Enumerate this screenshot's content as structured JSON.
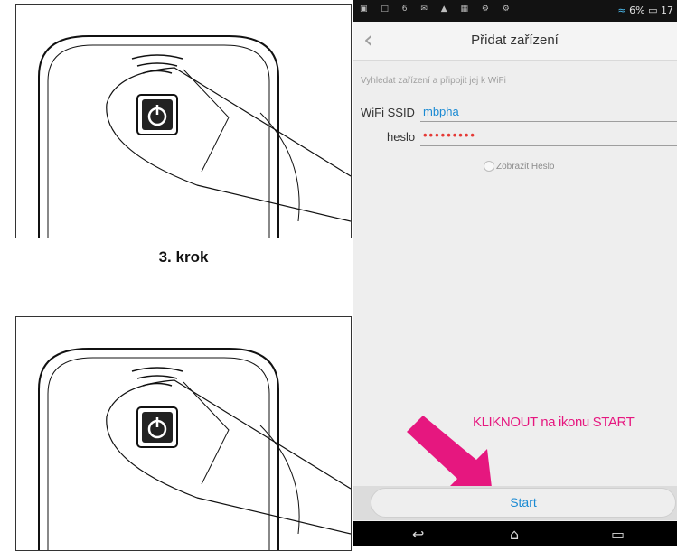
{
  "illustration": {
    "caption": "3. krok"
  },
  "status_bar": {
    "icons": "▣ □ 6 ✉ ▲ ▦ ⚙ ⚙",
    "battery_text": "6%",
    "time": "17"
  },
  "app": {
    "back_glyph": "‹",
    "title": "Přidat zařízení"
  },
  "form": {
    "hint": "Vyhledat zařízení a připojit jej k WiFi",
    "ssid_label": "WiFi SSID",
    "ssid_value": "mbpha",
    "password_label": "heslo",
    "password_value": "•••••••••",
    "show_password_label": "Zobrazit Heslo"
  },
  "annotation": {
    "text": "KLIKNOUT na ikonu START",
    "color": "#e6177f"
  },
  "start_button": {
    "label": "Start"
  },
  "nav_bar": {
    "back": "↩",
    "home": "⌂",
    "recents": "▭"
  }
}
